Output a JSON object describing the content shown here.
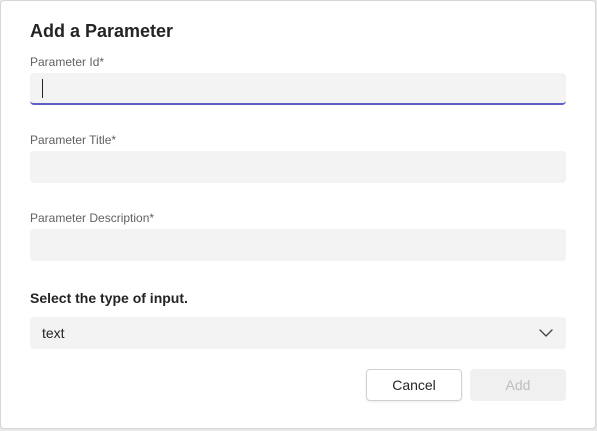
{
  "dialog": {
    "title": "Add a Parameter"
  },
  "fields": {
    "parameter_id": {
      "label": "Parameter Id",
      "required_mark": "*",
      "value": ""
    },
    "parameter_title": {
      "label": "Parameter Title",
      "required_mark": "*",
      "value": ""
    },
    "parameter_description": {
      "label": "Parameter Description",
      "required_mark": "*",
      "value": ""
    }
  },
  "input_type": {
    "label": "Select the type of input.",
    "selected": "text",
    "icon": "chevron-down-icon"
  },
  "buttons": {
    "cancel_label": "Cancel",
    "add_label": "Add"
  },
  "colors": {
    "accent": "#5b5fc7",
    "field_background": "#f3f3f3",
    "disabled_text": "#bdbdbd"
  }
}
